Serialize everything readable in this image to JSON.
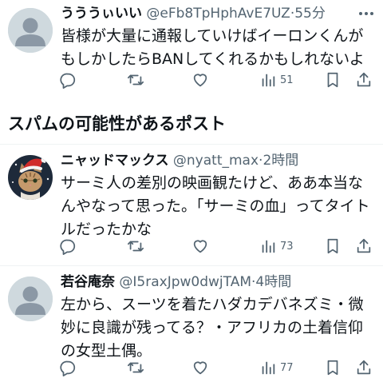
{
  "posts": [
    {
      "name": "うううぃいい",
      "handle": "@eFb8TpHphAvE7UZ",
      "dot": "·",
      "time": "55分",
      "text": "皆様が大量に通報していけばイーロンくんがもしかしたらBANしてくれるかもしれないよ",
      "views": "51",
      "avatar": "default-avatar"
    },
    {
      "name": "ニャッドマックス",
      "handle": "@nyatt_max",
      "dot": "·",
      "time": "2時間",
      "text": "サーミ人の差別の映画観たけど、ああ本当なんやなって思った。「サーミの血」ってタイトルだったかな",
      "views": "73",
      "avatar": "cat-avatar"
    },
    {
      "name": "若谷庵奈",
      "handle": "@I5raxJpw0dwjTAM",
      "dot": "·",
      "time": "4時間",
      "text": "左から、スーツを着たハダカデバネズミ・微妙に良識が残ってる？・アフリカの土着信仰の女型土偶。",
      "views": "77",
      "avatar": "default-avatar"
    }
  ],
  "section": {
    "title": "スパムの可能性があるポスト"
  },
  "icons": {
    "reply": "reply-icon",
    "repost": "repost-icon",
    "like": "like-icon",
    "views": "views-icon",
    "bookmark": "bookmark-icon",
    "share": "share-icon",
    "more": "more-icon"
  },
  "colors": {
    "text": "#0f1419",
    "muted": "#536471",
    "divider": "#eff3f4",
    "avatar_placeholder": "#cfd9de"
  }
}
